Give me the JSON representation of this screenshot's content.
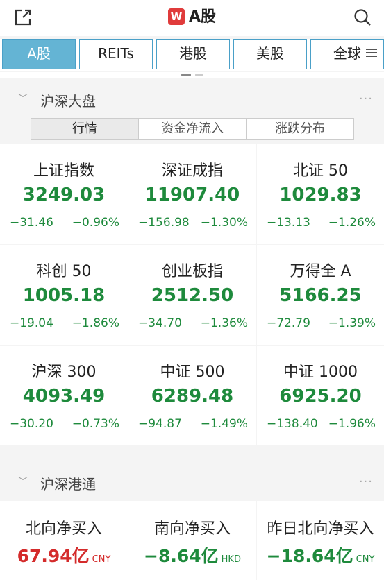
{
  "header": {
    "logo_text": "W",
    "title": "A股"
  },
  "tabs": [
    {
      "label": "A股"
    },
    {
      "label": "REITs"
    },
    {
      "label": "港股"
    },
    {
      "label": "美股"
    },
    {
      "label": "全球"
    }
  ],
  "market_section": {
    "label": "沪深大盘",
    "more": "···",
    "subtabs": [
      {
        "label": "行情"
      },
      {
        "label": "资金净流入"
      },
      {
        "label": "涨跌分布"
      }
    ]
  },
  "indices": [
    {
      "name": "上证指数",
      "price": "3249.03",
      "change": "−31.46",
      "pct": "−0.96%"
    },
    {
      "name": "深证成指",
      "price": "11907.40",
      "change": "−156.98",
      "pct": "−1.30%"
    },
    {
      "name": "北证 50",
      "price": "1029.83",
      "change": "−13.13",
      "pct": "−1.26%"
    },
    {
      "name": "科创 50",
      "price": "1005.18",
      "change": "−19.04",
      "pct": "−1.86%"
    },
    {
      "name": "创业板指",
      "price": "2512.50",
      "change": "−34.70",
      "pct": "−1.36%"
    },
    {
      "name": "万得全 A",
      "price": "5166.25",
      "change": "−72.79",
      "pct": "−1.39%"
    },
    {
      "name": "沪深 300",
      "price": "4093.49",
      "change": "−30.20",
      "pct": "−0.73%"
    },
    {
      "name": "中证 500",
      "price": "6289.48",
      "change": "−94.87",
      "pct": "−1.49%"
    },
    {
      "name": "中证 1000",
      "price": "6925.20",
      "change": "−138.40",
      "pct": "−1.96%"
    }
  ],
  "connect_section": {
    "label": "沪深港通",
    "more": "···"
  },
  "flows": [
    {
      "name": "北向净买入",
      "value": "67.94亿",
      "unit": "CNY",
      "color": "#d42b2b"
    },
    {
      "name": "南向净买入",
      "value": "−8.64亿",
      "unit": "HKD",
      "color": "#1e8a3c"
    },
    {
      "name": "昨日北向净买入",
      "value": "−18.64亿",
      "unit": "CNY",
      "color": "#1e8a3c"
    }
  ]
}
